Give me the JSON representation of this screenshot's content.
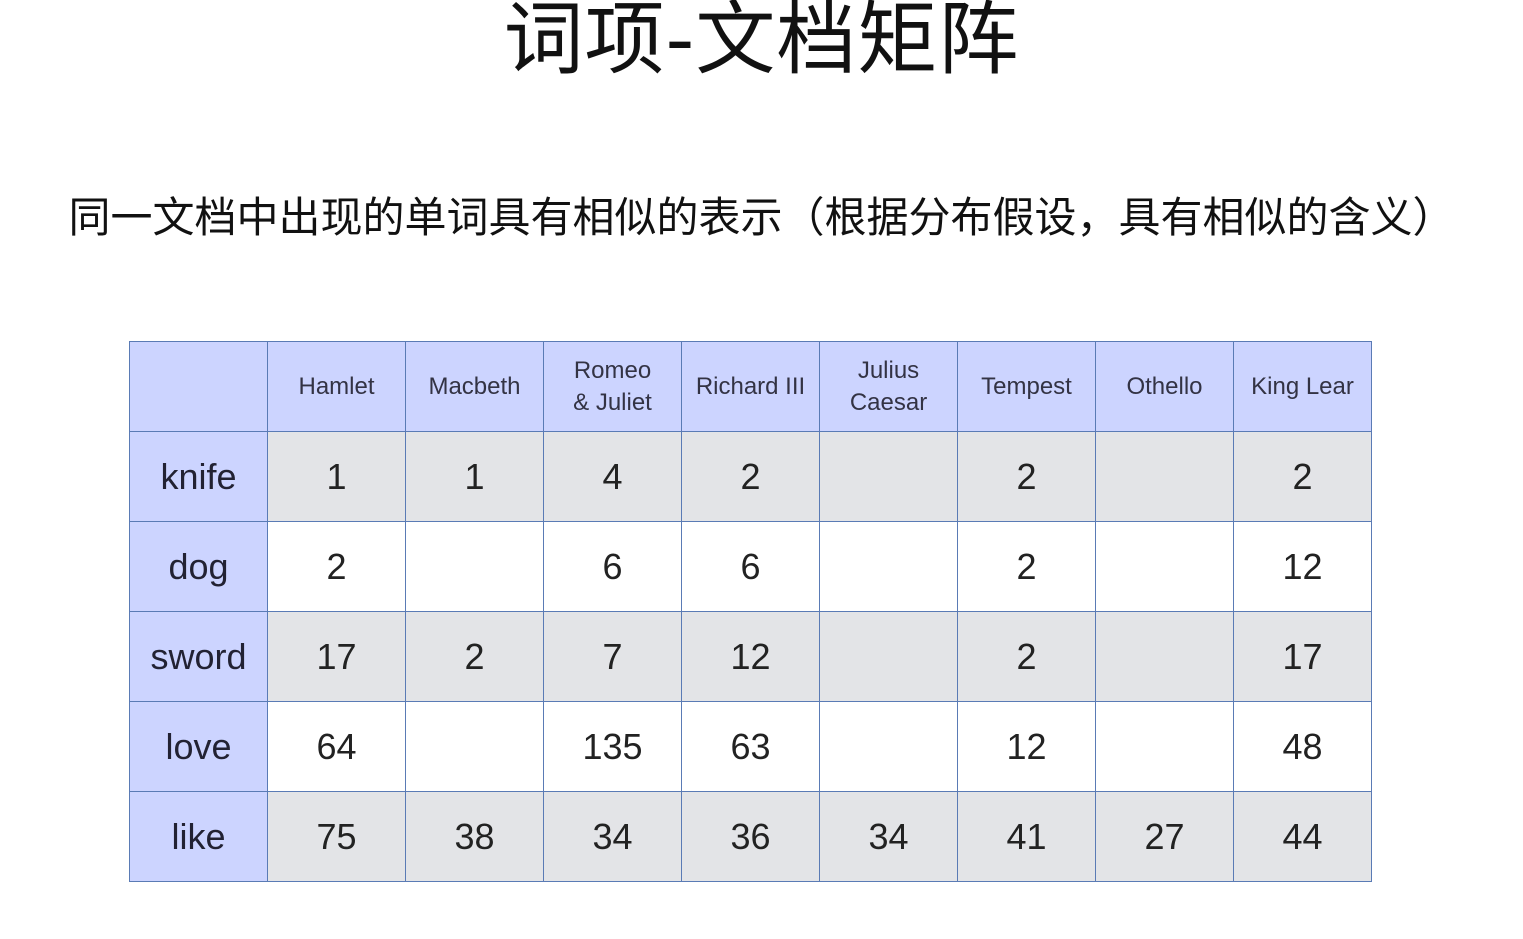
{
  "title": "词项-文档矩阵",
  "subtitle": "同一文档中出现的单词具有相似的表示（根据分布假设，具有相似的含义）",
  "table": {
    "corner": "",
    "columns": [
      [
        "Hamlet"
      ],
      [
        "Macbeth"
      ],
      [
        "Romeo",
        "& Juliet"
      ],
      [
        "Richard III"
      ],
      [
        "Julius",
        "Caesar"
      ],
      [
        "Tempest"
      ],
      [
        "Othello"
      ],
      [
        "King Lear"
      ]
    ],
    "rows": [
      {
        "term": "knife",
        "values": [
          "1",
          "1",
          "4",
          "2",
          "",
          "2",
          "",
          "2"
        ]
      },
      {
        "term": "dog",
        "values": [
          "2",
          "",
          "6",
          "6",
          "",
          "2",
          "",
          "12"
        ]
      },
      {
        "term": "sword",
        "values": [
          "17",
          "2",
          "7",
          "12",
          "",
          "2",
          "",
          "17"
        ]
      },
      {
        "term": "love",
        "values": [
          "64",
          "",
          "135",
          "63",
          "",
          "12",
          "",
          "48"
        ]
      },
      {
        "term": "like",
        "values": [
          "75",
          "38",
          "34",
          "36",
          "34",
          "41",
          "27",
          "44"
        ]
      }
    ]
  },
  "colors": {
    "header_bg": "#ccd4ff",
    "row_shaded_bg": "#e3e4e7",
    "row_plain_bg": "#ffffff",
    "border": "#5a7bb5"
  }
}
